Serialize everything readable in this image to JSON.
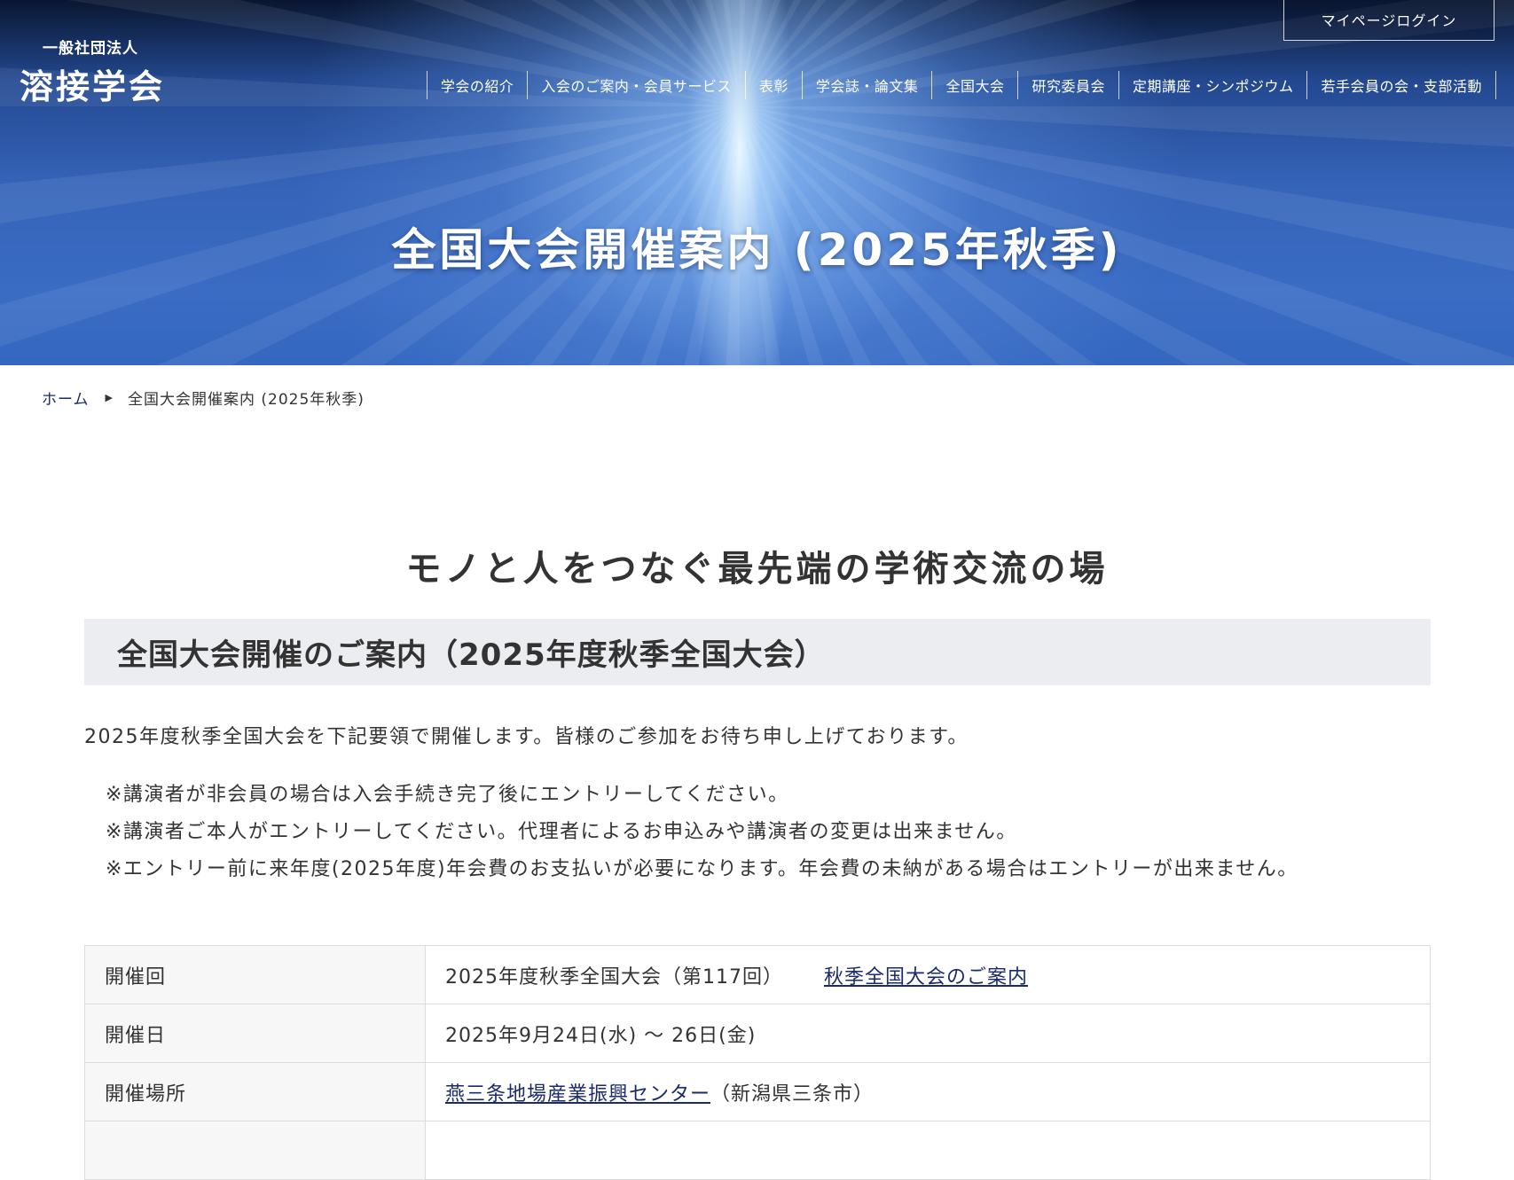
{
  "header": {
    "logo_sub": "一般社団法人",
    "logo_main": "溶接学会",
    "mypage_label": "マイページログイン",
    "nav": [
      "学会の紹介",
      "入会のご案内・会員サービス",
      "表彰",
      "学会誌・論文集",
      "全国大会",
      "研究委員会",
      "定期講座・シンポジウム",
      "若手会員の会・支部活動"
    ],
    "page_title": "全国大会開催案内 (2025年秋季)"
  },
  "breadcrumb": {
    "home": "ホーム",
    "separator": "▶",
    "current": "全国大会開催案内 (2025年秋季)"
  },
  "main": {
    "tagline": "モノと人をつなぐ最先端の学術交流の場",
    "section_title": "全国大会開催のご案内（2025年度秋季全国大会）",
    "intro": "2025年度秋季全国大会を下記要領で開催します。皆様のご参加をお待ち申し上げております。",
    "notes": [
      "※講演者が非会員の場合は入会手続き完了後にエントリーしてください。",
      "※講演者ご本人がエントリーしてください。代理者によるお申込みや講演者の変更は出来ません。",
      "※エントリー前に来年度(2025年度)年会費のお支払いが必要になります。年会費の未納がある場合はエントリーが出来ません。"
    ],
    "table": {
      "rows": [
        {
          "label": "開催回",
          "value": "2025年度秋季全国大会（第117回）",
          "link": "秋季全国大会のご案内"
        },
        {
          "label": "開催日",
          "value": "2025年9月24日(水) 〜 26日(金)"
        },
        {
          "label": "開催場所",
          "link": "燕三条地場産業振興センター",
          "value_suffix": "（新潟県三条市）"
        }
      ]
    }
  },
  "colors": {
    "link": "#1a2a6c",
    "section_bg": "#ecedf1",
    "hero_blue": "#3563b8"
  }
}
